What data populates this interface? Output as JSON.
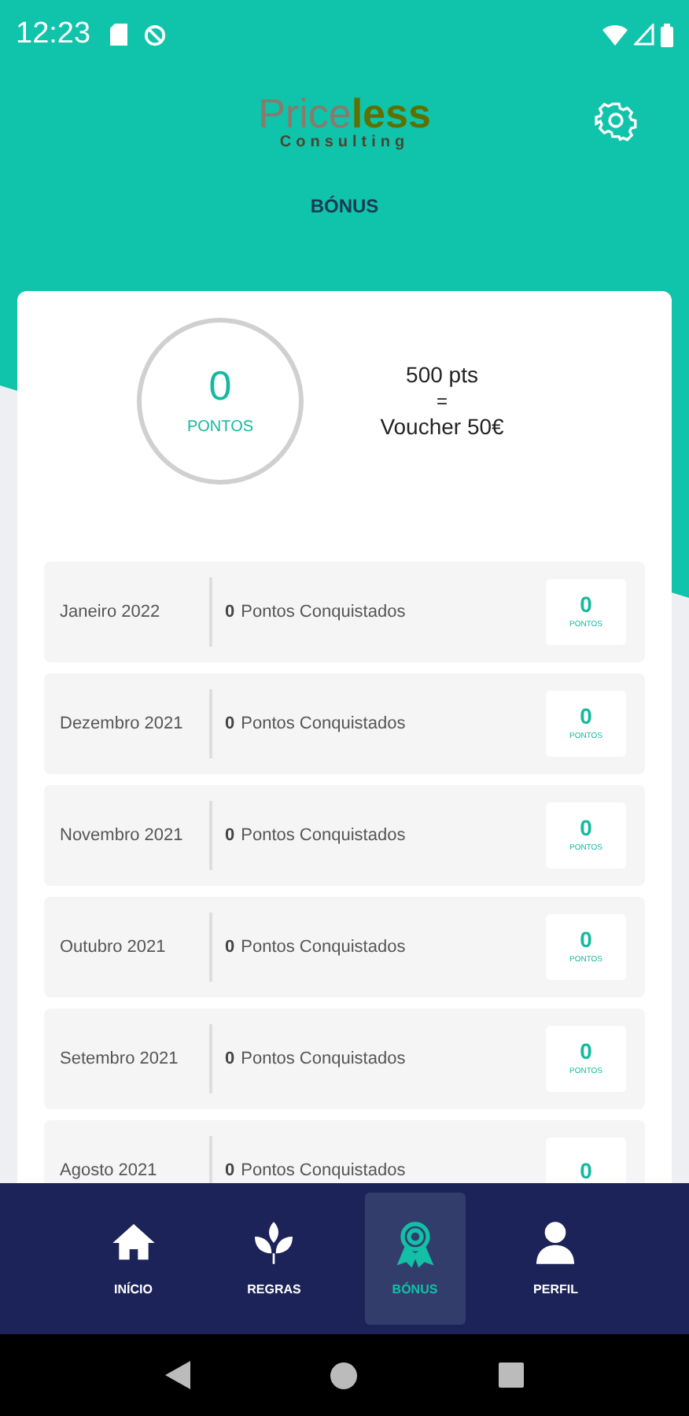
{
  "status_bar": {
    "time": "12:23"
  },
  "header": {
    "logo_primary": "Price",
    "logo_accent": "less",
    "logo_sub": "Consulting",
    "title": "BÓNUS"
  },
  "summary": {
    "points": "0",
    "points_label": "PONTOS",
    "rule_points": "500 pts",
    "rule_equals": "=",
    "rule_reward": "Voucher 50€"
  },
  "months": [
    {
      "month": "Janeiro 2022",
      "earned": "0",
      "earned_label": "Pontos Conquistados",
      "points": "0",
      "points_label": "PONTOS"
    },
    {
      "month": "Dezembro 2021",
      "earned": "0",
      "earned_label": "Pontos Conquistados",
      "points": "0",
      "points_label": "PONTOS"
    },
    {
      "month": "Novembro 2021",
      "earned": "0",
      "earned_label": "Pontos Conquistados",
      "points": "0",
      "points_label": "PONTOS"
    },
    {
      "month": "Outubro 2021",
      "earned": "0",
      "earned_label": "Pontos Conquistados",
      "points": "0",
      "points_label": "PONTOS"
    },
    {
      "month": "Setembro 2021",
      "earned": "0",
      "earned_label": "Pontos Conquistados",
      "points": "0",
      "points_label": "PONTOS"
    },
    {
      "month": "Agosto 2021",
      "earned": "0",
      "earned_label": "Pontos Conquistados",
      "points": "0"
    }
  ],
  "nav": [
    {
      "kind": "home",
      "label": "INÍCIO",
      "selected": false
    },
    {
      "kind": "leaves",
      "label": "REGRAS",
      "selected": false
    },
    {
      "kind": "medal",
      "label": "BÓNUS",
      "selected": true
    },
    {
      "kind": "person",
      "label": "PERFIL",
      "selected": false
    }
  ]
}
